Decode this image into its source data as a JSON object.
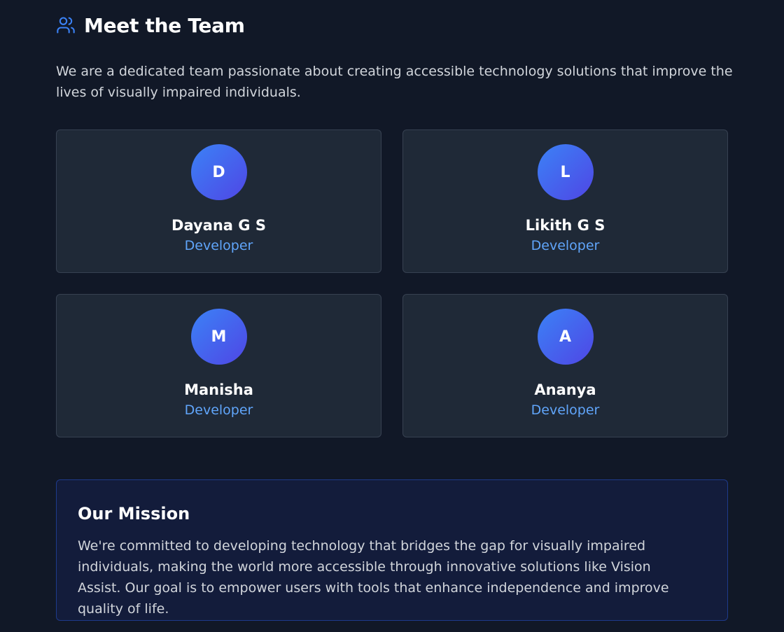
{
  "header": {
    "title": "Meet the Team",
    "icon": "users-icon",
    "icon_color": "#3b82f6"
  },
  "intro": "We are a dedicated team passionate about creating accessible technology solutions that improve the lives of visually impaired individuals.",
  "team": [
    {
      "initial": "D",
      "name": "Dayana G S",
      "role": "Developer"
    },
    {
      "initial": "L",
      "name": "Likith G S",
      "role": "Developer"
    },
    {
      "initial": "M",
      "name": "Manisha",
      "role": "Developer"
    },
    {
      "initial": "A",
      "name": "Ananya",
      "role": "Developer"
    }
  ],
  "mission": {
    "title": "Our Mission",
    "text": "We're committed to developing technology that bridges the gap for visually impaired individuals, making the world more accessible through innovative solutions like Vision Assist. Our goal is to empower users with tools that enhance independence and improve quality of life."
  },
  "colors": {
    "background": "#111827",
    "card": "#1f2937",
    "accent": "#60a5fa",
    "avatar_gradient": [
      "#3b82f6",
      "#4f46e5"
    ]
  }
}
